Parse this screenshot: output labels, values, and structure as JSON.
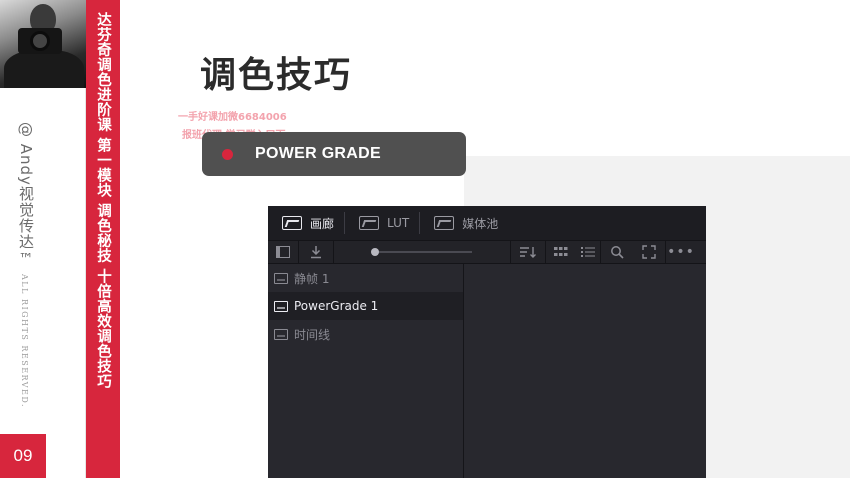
{
  "sidebar": {
    "series_title": "达芬奇调色进阶课  第一模块  调色秘技  十倍高效调色技巧",
    "credit": "@ Andy视觉传达™",
    "rights": "ALL RIGHTS RESERVED.",
    "page_number": "09"
  },
  "slide": {
    "title": "调色技巧",
    "watermark_line1": "一手好课加微6684006",
    "watermark_line2": "报班代理 学习群入口下",
    "section_label": "POWER GRADE"
  },
  "app": {
    "tabs": [
      {
        "label": "画廊",
        "icon": "gallery-icon",
        "active": true
      },
      {
        "label": "LUT",
        "icon": "lut-icon",
        "active": false
      },
      {
        "label": "媒体池",
        "icon": "media-pool-icon",
        "active": false
      }
    ],
    "toolbar": {
      "panel_toggle": "panel-toggle-icon",
      "import": "import-icon",
      "sort": "sort-icon",
      "grid_view": "grid-view-icon",
      "list_view": "list-view-icon",
      "search": "search-icon",
      "fullscreen": "fullscreen-icon",
      "more": "more-options-icon",
      "thumbnail_size": 0.02
    },
    "albums": [
      {
        "label": "静帧 1",
        "selected": false
      },
      {
        "label": "PowerGrade 1",
        "selected": true
      },
      {
        "label": "时间线",
        "selected": false
      }
    ]
  },
  "colors": {
    "accent": "#d7263d",
    "pill_bg": "#505050",
    "app_bg": "#28282e"
  }
}
